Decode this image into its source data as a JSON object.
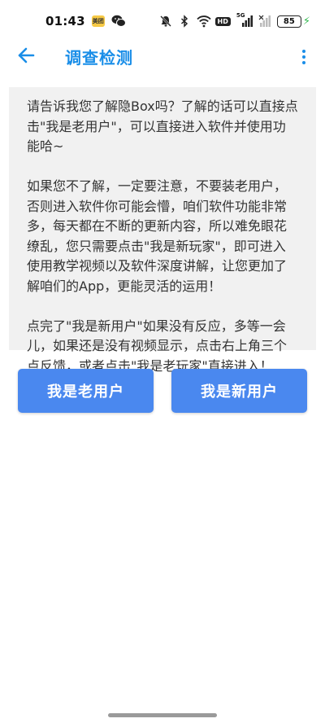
{
  "status_bar": {
    "time": "01:43",
    "app_icon_label": "美团",
    "hd_label": "HD",
    "network_label": "5G",
    "battery": "85",
    "icons": [
      "meituan-app-icon",
      "wechat-icon",
      "mute-icon",
      "bluetooth-icon",
      "wifi-icon",
      "hd-icon",
      "signal-icon",
      "signal-empty-icon",
      "battery-icon",
      "charging-icon"
    ]
  },
  "header": {
    "title": "调查检测",
    "back_icon": "arrow-left-icon",
    "more_icon": "more-vertical-icon"
  },
  "info": {
    "paragraphs": [
      "请告诉我您了解隐Box吗？了解的话可以直接点击\"我是老用户\"，可以直接进入软件并使用功能哈~",
      "如果您不了解，一定要注意，不要装老用户，否则进入软件你可能会懵，咱们软件功能非常多，每天都在不断的更新内容，所以难免眼花缭乱，您只需要点击\"我是新玩家\"，即可进入使用教学视频以及软件深度讲解，让您更加了解咱们的App，更能灵活的运用！",
      "点完了\"我是新用户\"如果没有反应，多等一会儿，如果还是没有视频显示，点击右上角三个点反馈，或者点击\"我是老玩家\"直接进入！"
    ]
  },
  "buttons": {
    "old_user": "我是老用户",
    "new_user": "我是新用户"
  },
  "colors": {
    "accent": "#1a8ee8",
    "button": "#4a88ef",
    "card_bg": "#f1f1f1"
  }
}
